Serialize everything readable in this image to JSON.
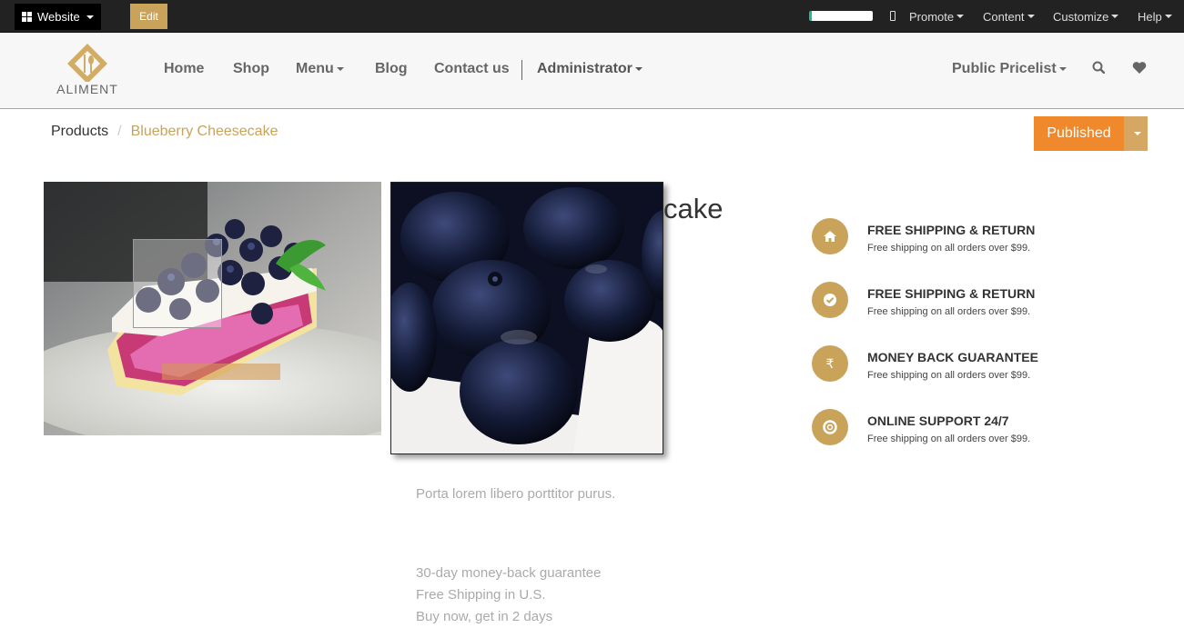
{
  "adminbar": {
    "website_label": "Website",
    "edit_label": "Edit",
    "menus": [
      "Promote",
      "Content",
      "Customize",
      "Help"
    ]
  },
  "logo_text": "ALIMENT",
  "nav": {
    "items": [
      "Home",
      "Shop",
      "Menu",
      "Blog",
      "Contact us",
      "Administrator"
    ],
    "pricelist": "Public Pricelist"
  },
  "breadcrumb": {
    "root": "Products",
    "current": "Blueberry Cheesecake"
  },
  "publish": {
    "label": "Published"
  },
  "product": {
    "title_visible": "cake",
    "description": "Porta lorem libero porttitor purus.",
    "features": [
      "30-day money-back guarantee",
      "Free Shipping in U.S.",
      "Buy now, get in 2 days"
    ]
  },
  "perks": [
    {
      "icon": "home-icon",
      "title": "FREE SHIPPING & RETURN",
      "sub": "Free shipping on all orders over $99."
    },
    {
      "icon": "check-icon",
      "title": "FREE SHIPPING & RETURN",
      "sub": "Free shipping on all orders over $99."
    },
    {
      "icon": "rupee-icon",
      "title": "MONEY BACK GUARANTEE",
      "sub": "Free shipping on all orders over $99."
    },
    {
      "icon": "lifebuoy-icon",
      "title": "ONLINE SUPPORT 24/7",
      "sub": "Free shipping on all orders over $99."
    }
  ],
  "colors": {
    "accent": "#c9a35a",
    "publish": "#f0892b",
    "adminbar": "#222222"
  }
}
